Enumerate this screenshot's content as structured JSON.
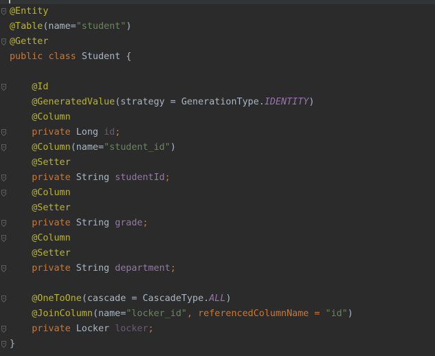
{
  "editor": {
    "lines": [
      {
        "fold": true,
        "tokens": [
          {
            "t": "@Entity",
            "c": "ann"
          }
        ]
      },
      {
        "fold": false,
        "tokens": [
          {
            "t": "@Table",
            "c": "ann"
          },
          {
            "t": "(name=",
            "c": "plain"
          },
          {
            "t": "\"student\"",
            "c": "str"
          },
          {
            "t": ")",
            "c": "plain"
          }
        ]
      },
      {
        "fold": true,
        "tokens": [
          {
            "t": "@Getter",
            "c": "ann"
          }
        ]
      },
      {
        "fold": false,
        "tokens": [
          {
            "t": "public ",
            "c": "kw"
          },
          {
            "t": "class ",
            "c": "kw"
          },
          {
            "t": "Student {",
            "c": "plain"
          }
        ]
      },
      {
        "fold": false,
        "tokens": []
      },
      {
        "fold": true,
        "tokens": [
          {
            "t": "    ",
            "c": "plain"
          },
          {
            "t": "@Id",
            "c": "ann"
          }
        ]
      },
      {
        "fold": false,
        "tokens": [
          {
            "t": "    ",
            "c": "plain"
          },
          {
            "t": "@GeneratedValue",
            "c": "ann"
          },
          {
            "t": "(strategy = GenerationType.",
            "c": "plain"
          },
          {
            "t": "IDENTITY",
            "c": "const"
          },
          {
            "t": ")",
            "c": "plain"
          }
        ]
      },
      {
        "fold": false,
        "tokens": [
          {
            "t": "    ",
            "c": "plain"
          },
          {
            "t": "@Column",
            "c": "ann"
          }
        ]
      },
      {
        "fold": true,
        "tokens": [
          {
            "t": "    ",
            "c": "plain"
          },
          {
            "t": "private ",
            "c": "kw"
          },
          {
            "t": "Long ",
            "c": "plain"
          },
          {
            "t": "id",
            "c": "field-unused"
          },
          {
            "t": ";",
            "c": "kw"
          }
        ]
      },
      {
        "fold": true,
        "tokens": [
          {
            "t": "    ",
            "c": "plain"
          },
          {
            "t": "@Column",
            "c": "ann"
          },
          {
            "t": "(name=",
            "c": "plain"
          },
          {
            "t": "\"student_id\"",
            "c": "str"
          },
          {
            "t": ")",
            "c": "plain"
          }
        ]
      },
      {
        "fold": false,
        "tokens": [
          {
            "t": "    ",
            "c": "plain"
          },
          {
            "t": "@Setter",
            "c": "ann"
          }
        ]
      },
      {
        "fold": true,
        "tokens": [
          {
            "t": "    ",
            "c": "plain"
          },
          {
            "t": "private ",
            "c": "kw"
          },
          {
            "t": "String ",
            "c": "plain"
          },
          {
            "t": "studentId",
            "c": "field"
          },
          {
            "t": ";",
            "c": "kw"
          }
        ]
      },
      {
        "fold": true,
        "tokens": [
          {
            "t": "    ",
            "c": "plain"
          },
          {
            "t": "@Column",
            "c": "ann"
          }
        ]
      },
      {
        "fold": false,
        "tokens": [
          {
            "t": "    ",
            "c": "plain"
          },
          {
            "t": "@Setter",
            "c": "ann"
          }
        ]
      },
      {
        "fold": true,
        "tokens": [
          {
            "t": "    ",
            "c": "plain"
          },
          {
            "t": "private ",
            "c": "kw"
          },
          {
            "t": "String ",
            "c": "plain"
          },
          {
            "t": "grade",
            "c": "field"
          },
          {
            "t": ";",
            "c": "kw"
          }
        ]
      },
      {
        "fold": true,
        "tokens": [
          {
            "t": "    ",
            "c": "plain"
          },
          {
            "t": "@Column",
            "c": "ann"
          }
        ]
      },
      {
        "fold": false,
        "tokens": [
          {
            "t": "    ",
            "c": "plain"
          },
          {
            "t": "@Setter",
            "c": "ann"
          }
        ]
      },
      {
        "fold": true,
        "tokens": [
          {
            "t": "    ",
            "c": "plain"
          },
          {
            "t": "private ",
            "c": "kw"
          },
          {
            "t": "String ",
            "c": "plain"
          },
          {
            "t": "department",
            "c": "field"
          },
          {
            "t": ";",
            "c": "kw"
          }
        ]
      },
      {
        "fold": false,
        "tokens": []
      },
      {
        "fold": true,
        "tokens": [
          {
            "t": "    ",
            "c": "plain"
          },
          {
            "t": "@OneToOne",
            "c": "ann"
          },
          {
            "t": "(cascade = CascadeType.",
            "c": "plain"
          },
          {
            "t": "ALL",
            "c": "const"
          },
          {
            "t": ")",
            "c": "plain"
          }
        ]
      },
      {
        "fold": false,
        "tokens": [
          {
            "t": "    ",
            "c": "plain"
          },
          {
            "t": "@JoinColumn",
            "c": "ann"
          },
          {
            "t": "(name=",
            "c": "plain"
          },
          {
            "t": "\"locker_id\"",
            "c": "str"
          },
          {
            "t": ", referencedColumnName = ",
            "c": "kw"
          },
          {
            "t": "\"id\"",
            "c": "str"
          },
          {
            "t": ")",
            "c": "plain"
          }
        ]
      },
      {
        "fold": true,
        "tokens": [
          {
            "t": "    ",
            "c": "plain"
          },
          {
            "t": "private ",
            "c": "kw"
          },
          {
            "t": "Locker ",
            "c": "plain"
          },
          {
            "t": "locker",
            "c": "field-unused"
          },
          {
            "t": ";",
            "c": "kw"
          }
        ]
      },
      {
        "fold": true,
        "tokens": [
          {
            "t": "}",
            "c": "plain"
          }
        ]
      }
    ]
  },
  "colors": {
    "background": "#2b2b2b",
    "annotation": "#bbb529",
    "keyword": "#cc7832",
    "string": "#6a8759",
    "plain": "#a9b7c6",
    "field": "#9876aa",
    "fold_marker": "#5e6060"
  },
  "icons": {
    "fold_marker": "fold-marker-icon"
  }
}
